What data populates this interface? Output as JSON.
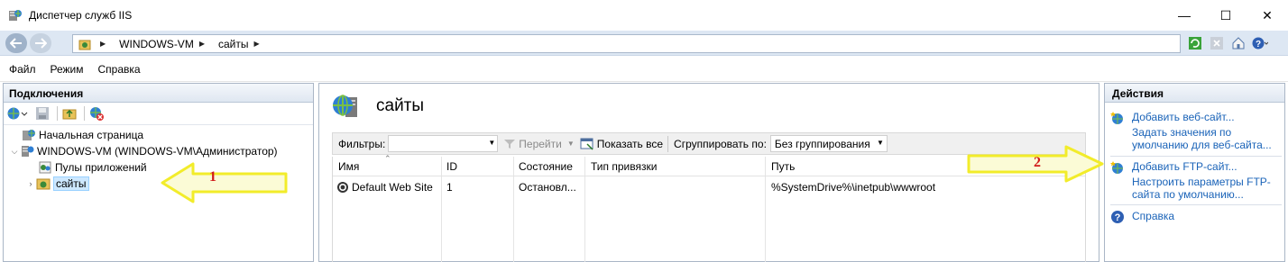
{
  "window": {
    "title": "Диспетчер служб IIS",
    "controls": {
      "minimize": "—",
      "maximize": "☐",
      "close": "✕"
    }
  },
  "address": {
    "crumbs": [
      "WINDOWS-VM",
      "сайты"
    ]
  },
  "menu": [
    "Файл",
    "Режим",
    "Справка"
  ],
  "connections": {
    "header": "Подключения",
    "tree": {
      "start_page": "Начальная страница",
      "server": "WINDOWS-VM (WINDOWS-VM\\Администратор)",
      "app_pools": "Пулы приложений",
      "sites": "сайты"
    }
  },
  "content": {
    "title": "сайты",
    "filter_label": "Фильтры:",
    "go_label": "Перейти",
    "show_all_label": "Показать все",
    "group_by_label": "Сгруппировать по:",
    "group_value": "Без группирования",
    "columns": [
      "Имя",
      "ID",
      "Состояние",
      "Тип привязки",
      "Путь"
    ],
    "rows": [
      {
        "name": "Default Web Site",
        "id": "1",
        "state": "Остановл...",
        "binding": "",
        "path": "%SystemDrive%\\inetpub\\wwwroot"
      }
    ]
  },
  "actions": {
    "header": "Действия",
    "add_site": "Добавить веб-сайт...",
    "set_defaults": "Задать значения по умолчанию для веб-сайта...",
    "add_ftp": "Добавить FTP-сайт...",
    "ftp_defaults": "Настроить параметры FTP-сайта по умолчанию...",
    "help": "Справка"
  },
  "annotations": {
    "arrow1_label": "1",
    "arrow2_label": "2"
  },
  "colors": {
    "accent_link": "#1a63b8",
    "annotation_arrow": "#ffff44",
    "annotation_number": "#d11a1a",
    "selection": "#cde8ff"
  }
}
